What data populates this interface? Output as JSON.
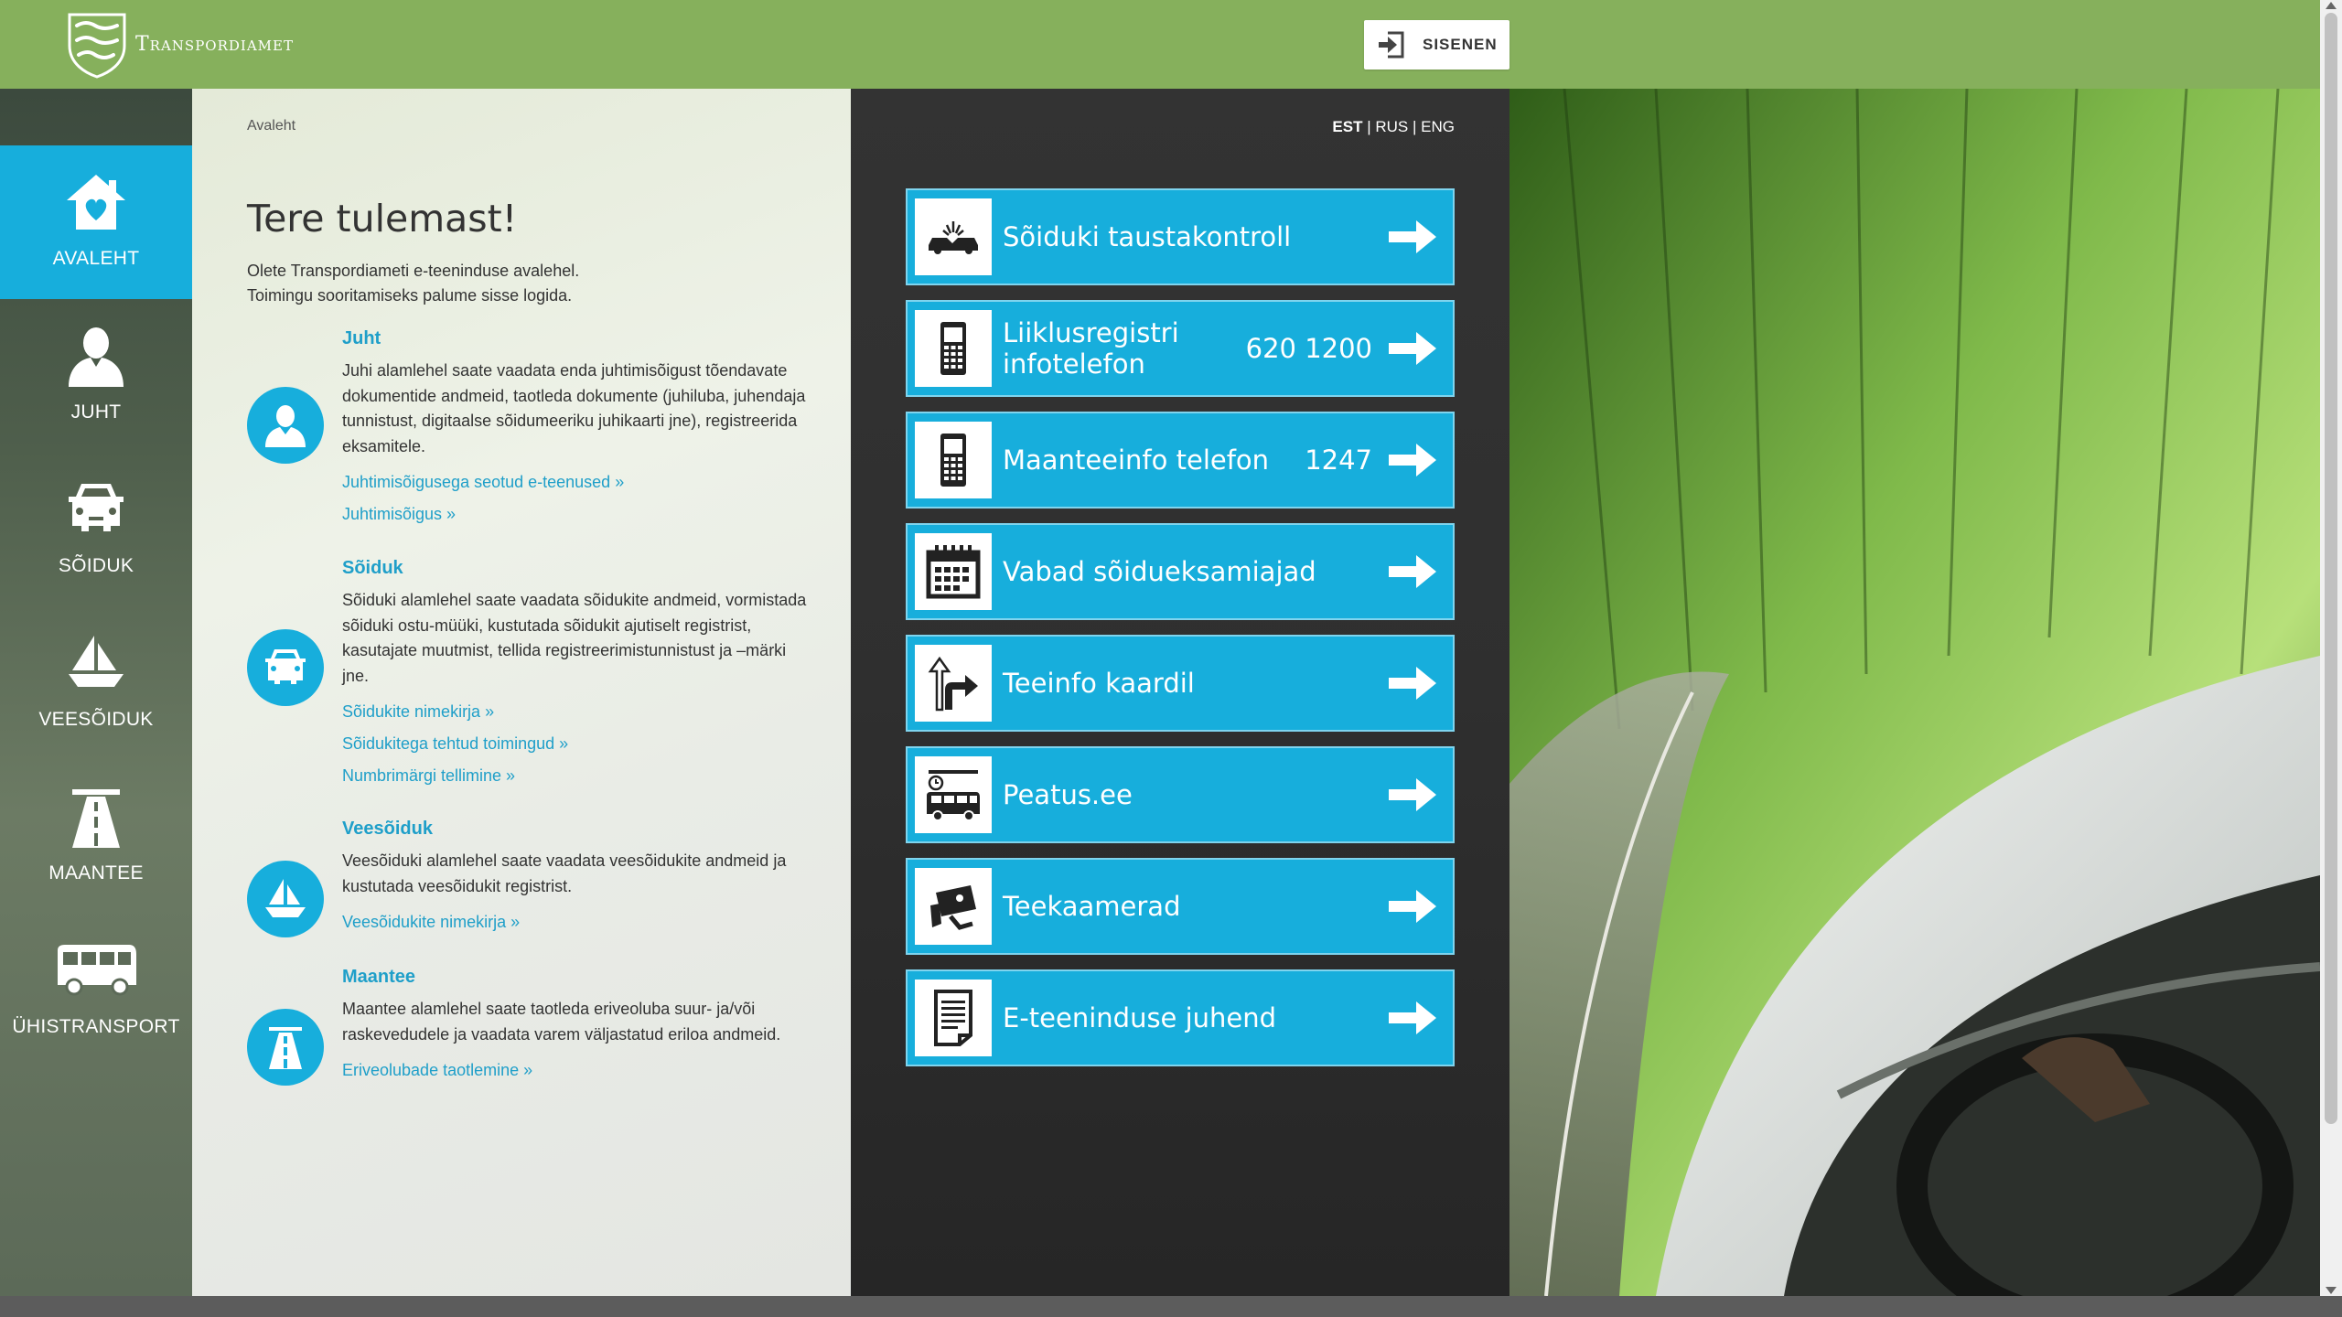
{
  "header": {
    "brand": "Transpordiamet",
    "login_label": "SISENEN"
  },
  "sidebar": {
    "items": [
      {
        "label": "AVALEHT",
        "icon": "home-icon",
        "active": true
      },
      {
        "label": "JUHT",
        "icon": "driver-icon",
        "active": false
      },
      {
        "label": "SÕIDUK",
        "icon": "car-icon",
        "active": false
      },
      {
        "label": "VEESÕIDUK",
        "icon": "boat-icon",
        "active": false
      },
      {
        "label": "MAANTEE",
        "icon": "road-icon",
        "active": false
      },
      {
        "label": "ÜHISTRANSPORT",
        "icon": "bus-icon",
        "active": false
      }
    ]
  },
  "content": {
    "breadcrumb": "Avaleht",
    "title": "Tere tulemast!",
    "intro_line1": "Olete Transpordiameti e-teeninduse avalehel.",
    "intro_line2": "Toimingu sooritamiseks palume sisse logida.",
    "sections": [
      {
        "title": "Juht",
        "text": "Juhi alamlehel saate vaadata enda juhtimisõigust tõendavate dokumentide andmeid, taotleda dokumente (juhiluba, juhendaja tunnistust, digitaalse sõidumeeriku juhikaarti jne), registreerida eksamitele.",
        "links": [
          "Juhtimisõigusega seotud e-teenused »",
          "Juhtimisõigus »"
        ]
      },
      {
        "title": "Sõiduk",
        "text": "Sõiduki alamlehel saate vaadata sõidukite andmeid, vormistada sõiduki ostu-müüki, kustutada sõidukit ajutiselt registrist, kasutajate muutmist, tellida registreerimistunnistust ja –märki jne.",
        "links": [
          "Sõidukite nimekirja »",
          "Sõidukitega tehtud toimingud »",
          "Numbrimärgi tellimine »"
        ]
      },
      {
        "title": "Veesõiduk",
        "text": "Veesõiduki alamlehel saate vaadata veesõidukite andmeid ja kustutada veesõidukit registrist.",
        "links": [
          "Veesõidukite nimekirja »"
        ]
      },
      {
        "title": "Maantee",
        "text": "Maantee alamlehel saate taotleda eriveoluba suur- ja/või raskevedudele ja vaadata varem väljastatud eriloa andmeid.",
        "links": [
          "Eriveolubade taotlemine »"
        ]
      }
    ]
  },
  "languages": {
    "est": "EST",
    "rus": "RUS",
    "eng": "ENG",
    "sep": "|"
  },
  "tiles": [
    {
      "label": "Sõiduki taustakontroll",
      "number": "",
      "icon": "car-crash-icon"
    },
    {
      "label": "Liiklusregistri infotelefon",
      "number": "620 1200",
      "icon": "phone-icon"
    },
    {
      "label": "Maanteeinfo telefon",
      "number": "1247",
      "icon": "phone-icon"
    },
    {
      "label": "Vabad sõidueksamiajad",
      "number": "",
      "icon": "calendar-icon"
    },
    {
      "label": "Teeinfo kaardil",
      "number": "",
      "icon": "road-sign-icon"
    },
    {
      "label": "Peatus.ee",
      "number": "",
      "icon": "bus-stop-icon"
    },
    {
      "label": "Teekaamerad",
      "number": "",
      "icon": "camera-icon"
    },
    {
      "label": "E-teeninduse juhend",
      "number": "",
      "icon": "document-icon"
    }
  ],
  "colors": {
    "header": "#86b05c",
    "accent": "#17aedc",
    "link": "#1f9fc9",
    "dark_panel": "#2f2f2f"
  }
}
